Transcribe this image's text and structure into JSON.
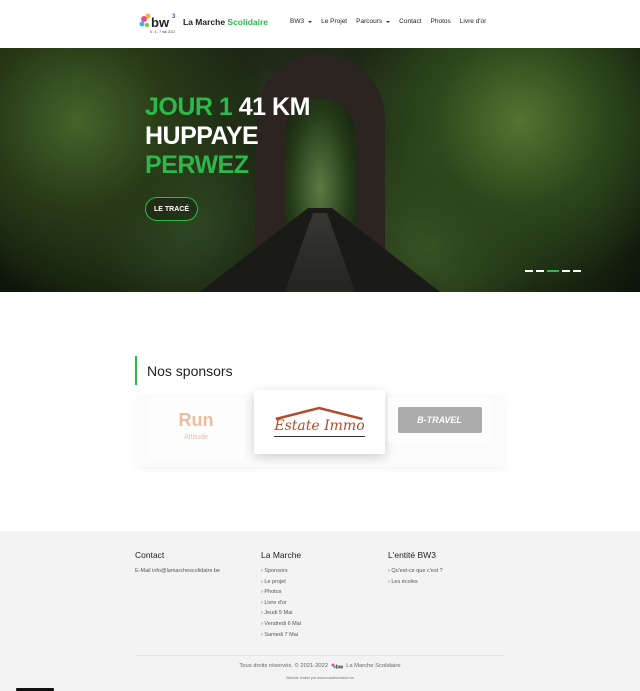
{
  "brand": {
    "prefix": "La Marche ",
    "highlight": "Scolidaire",
    "logo_text": "bw",
    "logo_sub": "5 - 6 - 7 mai 2022"
  },
  "nav": [
    {
      "label": "BW3",
      "dropdown": true
    },
    {
      "label": "Le Projet",
      "dropdown": false
    },
    {
      "label": "Parcours",
      "dropdown": true
    },
    {
      "label": "Contact",
      "dropdown": false
    },
    {
      "label": "Photos",
      "dropdown": false
    },
    {
      "label": "Livre d'or",
      "dropdown": false
    }
  ],
  "hero": {
    "line1_green": "JOUR 1",
    "line1_white": " 41 KM",
    "line2": "HUPPAYE",
    "line3": "PERWEZ",
    "button": "LE TRACÉ",
    "slides": 5,
    "active_slide": 3
  },
  "sponsors": {
    "title": "Nos sponsors",
    "items": [
      {
        "name": "Run Attitude",
        "main": "Run",
        "sub": "Attitude"
      },
      {
        "name": "Estate Immo"
      },
      {
        "name": "B-TRAVEL"
      }
    ]
  },
  "footer": {
    "contact": {
      "title": "Contact",
      "email": "E-Mail info@lamarchescolidaire.be"
    },
    "marche": {
      "title": "La Marche",
      "items": [
        "› Sponsors",
        "› Le projet",
        "› Photos",
        "› Livre d'or",
        "› Jeudi 5 Mai",
        "› Vendredi 6 Mai",
        "› Samedi 7 Mai"
      ]
    },
    "entite": {
      "title": "L'entité BW3",
      "items": [
        "› Qu'est-ce que c'est ?",
        "› Les écoles"
      ]
    },
    "copyright_pre": "Tous droits réservés. © 2021-2022",
    "copyright_post": "La Marche Scolidaire",
    "credit": "Website réalisé par www.mswebcreation.be"
  },
  "colors": {
    "accent": "#2cb84a"
  }
}
